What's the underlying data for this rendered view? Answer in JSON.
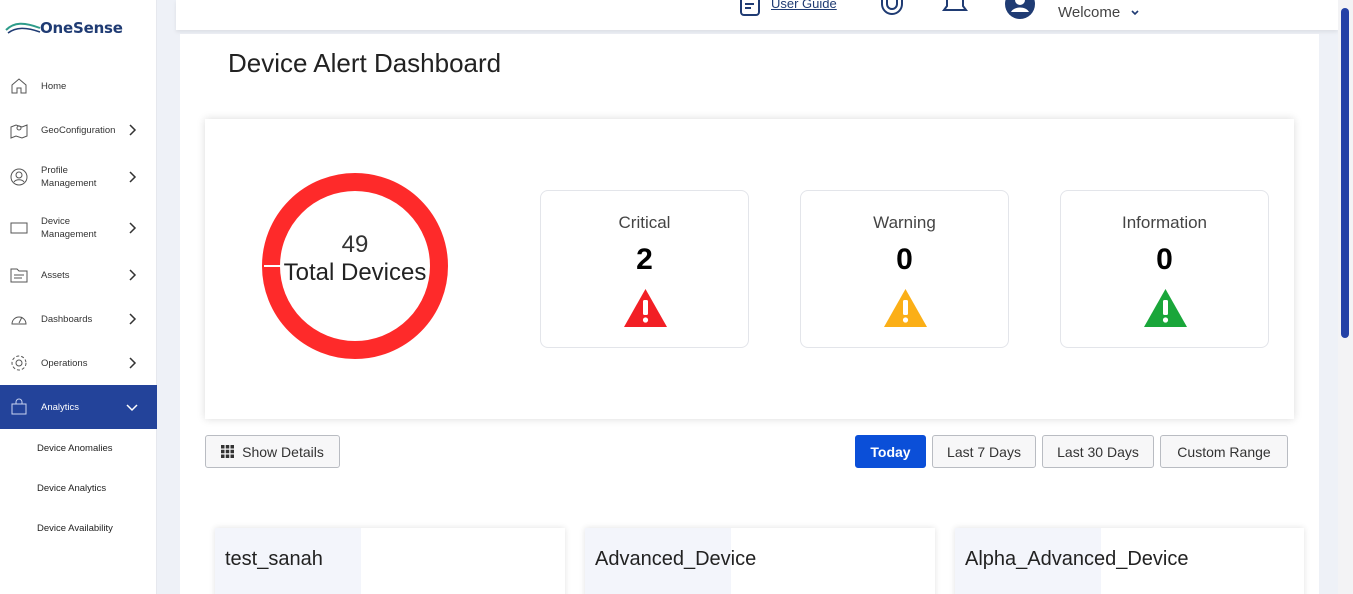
{
  "brand": {
    "name": "OneSense"
  },
  "sidebar": {
    "items": [
      {
        "label": "Home",
        "icon": "home-icon",
        "has_chevron": false
      },
      {
        "label": "GeoConfiguration",
        "icon": "map-icon",
        "has_chevron": true
      },
      {
        "label": "Profile Management",
        "icon": "user-circle-icon",
        "has_chevron": true
      },
      {
        "label": "Device Management",
        "icon": "monitor-icon",
        "has_chevron": true
      },
      {
        "label": "Assets",
        "icon": "assets-icon",
        "has_chevron": true
      },
      {
        "label": "Dashboards",
        "icon": "gauge-icon",
        "has_chevron": true
      },
      {
        "label": "Operations",
        "icon": "gear-icon",
        "has_chevron": true
      },
      {
        "label": "Analytics",
        "icon": "bag-icon",
        "has_chevron": true,
        "active": true
      }
    ],
    "sub_items": [
      {
        "label": "Device Anomalies"
      },
      {
        "label": "Device Analytics"
      },
      {
        "label": "Device Availability"
      }
    ]
  },
  "header": {
    "user_guide": "User Guide",
    "welcome": "Welcome"
  },
  "main": {
    "title": "Device Alert Dashboard",
    "summary": {
      "total_count": "49",
      "total_label": "Total Devices",
      "donut_color": "#fe2a2a",
      "cards": [
        {
          "title": "Critical",
          "value": "2",
          "color": "#f21f25"
        },
        {
          "title": "Warning",
          "value": "0",
          "color": "#fbaf17"
        },
        {
          "title": "Information",
          "value": "0",
          "color": "#1aa63a"
        }
      ]
    },
    "show_details": "Show Details",
    "ranges": [
      {
        "label": "Today",
        "active": true
      },
      {
        "label": "Last 7 Days",
        "active": false
      },
      {
        "label": "Last 30 Days",
        "active": false
      },
      {
        "label": "Custom Range",
        "active": false
      }
    ],
    "devices": [
      {
        "name": "test_sanah"
      },
      {
        "name": "Advanced_Device"
      },
      {
        "name": "Alpha_Advanced_Device"
      }
    ]
  },
  "colors": {
    "accent": "#23439a",
    "primary_button": "#0b4fd8"
  }
}
